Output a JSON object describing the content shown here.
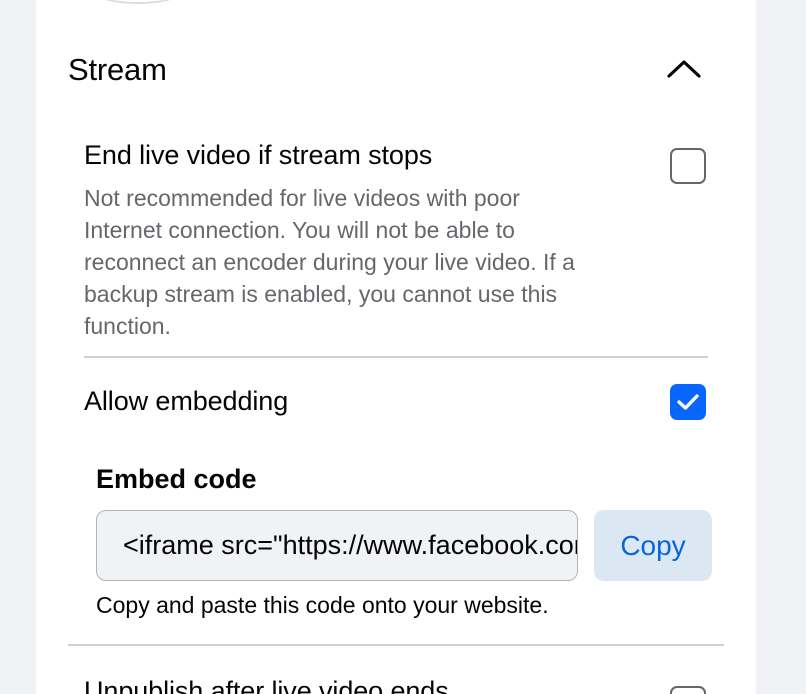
{
  "stream": {
    "title": "Stream",
    "collapse_icon": "chevron-up-icon",
    "end_live": {
      "label": "End live video if stream stops",
      "description_lines": [
        "Not recommended for live videos with poor",
        "Internet connection. You will not be able to",
        "reconnect an encoder during your live video. If a",
        "backup stream is enabled, you cannot use this",
        "function."
      ],
      "checked": false
    },
    "allow_embedding": {
      "label": "Allow embedding",
      "checked": true
    },
    "embed": {
      "label": "Embed code",
      "value": "<iframe src=\"https://www.facebook.com/plugins/video.php",
      "copy_label": "Copy",
      "helper": "Copy and paste this code onto your website."
    },
    "unpublish": {
      "label": "Unpublish after live video ends",
      "checked": false
    }
  },
  "colors": {
    "accent": "#0866ff",
    "copy_button_bg": "#dbe7f2",
    "copy_button_text": "#0a67d1",
    "secondary_text": "#65676b"
  }
}
